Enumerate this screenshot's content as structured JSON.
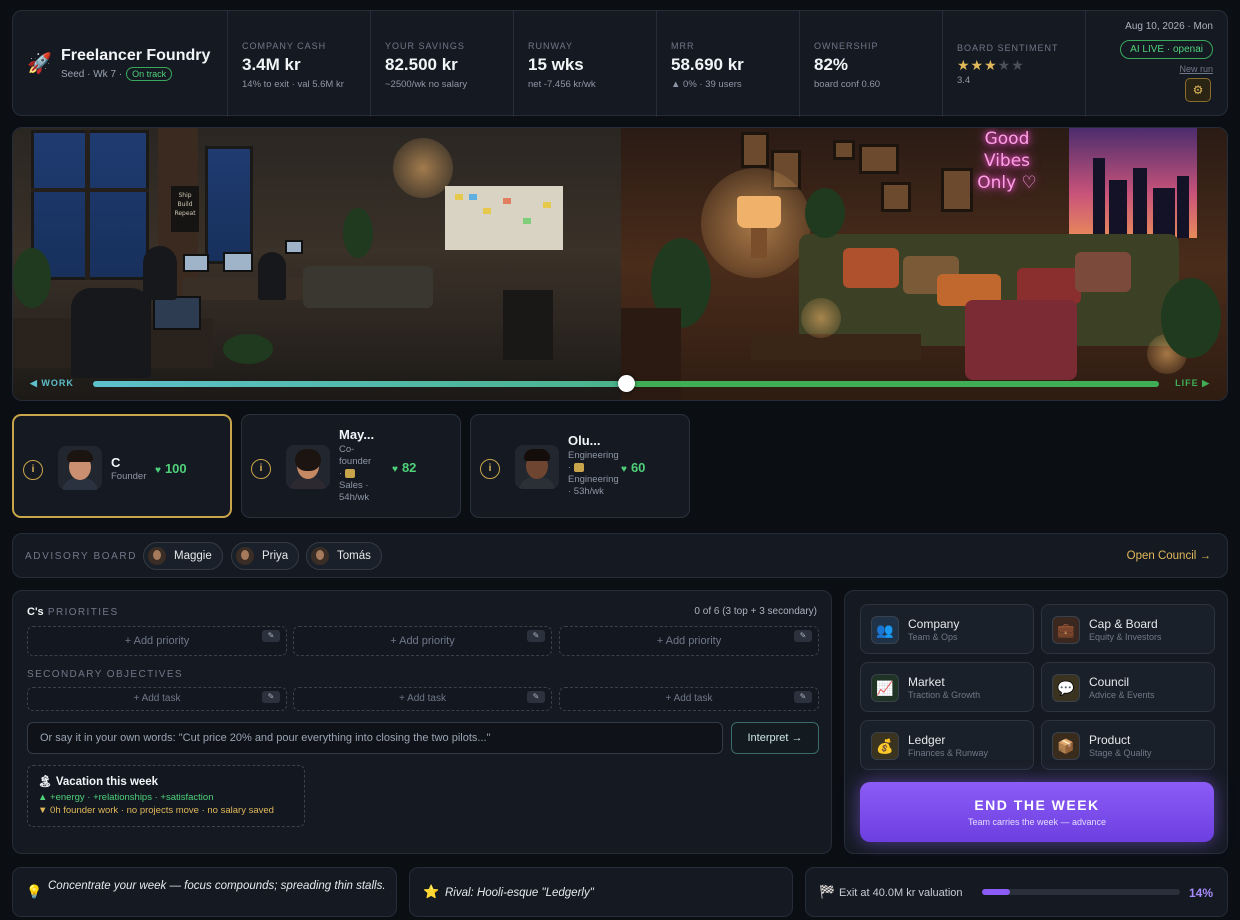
{
  "header": {
    "title": "Freelancer Foundry",
    "stage": "Seed · Wk 7 ·",
    "status": "On track",
    "stats": [
      {
        "label": "COMPANY CASH",
        "value": "3.4M kr",
        "sub": "14% to exit · val 5.6M kr"
      },
      {
        "label": "YOUR SAVINGS",
        "value": "82.500 kr",
        "sub": "~2500/wk no salary"
      },
      {
        "label": "RUNWAY",
        "value": "15 wks",
        "sub": "net -7.456 kr/wk"
      },
      {
        "label": "MRR",
        "value": "58.690 kr",
        "sub": "▲ 0% · 39 users"
      },
      {
        "label": "OWNERSHIP",
        "value": "82%",
        "sub": "board conf 0.60"
      }
    ],
    "sentiment": {
      "label": "BOARD SENTIMENT",
      "stars_on": "★★★",
      "stars_off": "★★",
      "value": "3.4"
    },
    "date": "Aug 10, 2026 · Mon",
    "ai_live": "AI LIVE · openai",
    "new_run": "New run"
  },
  "scene": {
    "work_label": "◀ WORK",
    "life_label": "LIFE ▶",
    "neon": "Good Vibes Only ♡",
    "poster": "Ship Build Repeat",
    "balance": 0.5
  },
  "team": [
    {
      "name": "C",
      "role": "Founder",
      "score": "100",
      "info": "i"
    },
    {
      "name": "May...",
      "role1": "Co-",
      "role2": "founder",
      "role3": "·",
      "role4": "Sales ·",
      "role5": "54h/wk",
      "score": "82",
      "info": "i"
    },
    {
      "name": "Olu...",
      "role1": "Engineering",
      "role2": "·",
      "role3": "Engineering",
      "role4": "· 53h/wk",
      "score": "60",
      "info": "i"
    }
  ],
  "advisory": {
    "label": "ADVISORY BOARD",
    "members": [
      "Maggie",
      "Priya",
      "Tomás"
    ],
    "open_council": "Open Council →"
  },
  "priorities": {
    "owner": "C's",
    "title": "PRIORITIES",
    "count": "0 of 6 (3 top + 3 secondary)",
    "add_priority": "+ Add priority",
    "secondary_title": "SECONDARY OBJECTIVES",
    "add_task": "+ Add task",
    "free_text": "Or say it in your own words: \"Cut price 20% and pour everything into closing the two pilots...\"",
    "interpret": "Interpret →",
    "vacation_title": "Vacation this week",
    "vacation_up": "▲ +energy · +relationships · +satisfaction",
    "vacation_down": "▼ 0h founder work · no projects move · no salary saved"
  },
  "nav": {
    "tiles": [
      {
        "label": "Company",
        "sub": "Team & Ops",
        "icon": "people-icon"
      },
      {
        "label": "Cap & Board",
        "sub": "Equity & Investors",
        "icon": "briefcase-icon"
      },
      {
        "label": "Market",
        "sub": "Traction & Growth",
        "icon": "chart-icon"
      },
      {
        "label": "Council",
        "sub": "Advice & Events",
        "icon": "speech-bubble-icon"
      },
      {
        "label": "Ledger",
        "sub": "Finances & Runway",
        "icon": "money-bag-icon"
      },
      {
        "label": "Product",
        "sub": "Stage & Quality",
        "icon": "box-icon"
      }
    ],
    "end_week": "END THE WEEK",
    "end_week_sub": "Team carries the week — advance"
  },
  "footer": {
    "tip": "Concentrate your week — focus compounds; spreading thin stalls.",
    "rival": "Rival: Hooli-esque \"Ledgerly\"",
    "exit_label": "Exit at 40.0M kr valuation",
    "exit_pct": "14%",
    "exit_progress": 0.14
  },
  "colors": {
    "accent": "#8b5cf6",
    "gold": "#e1b85a",
    "positive": "#4fd17a",
    "background": "#0b0e13"
  }
}
